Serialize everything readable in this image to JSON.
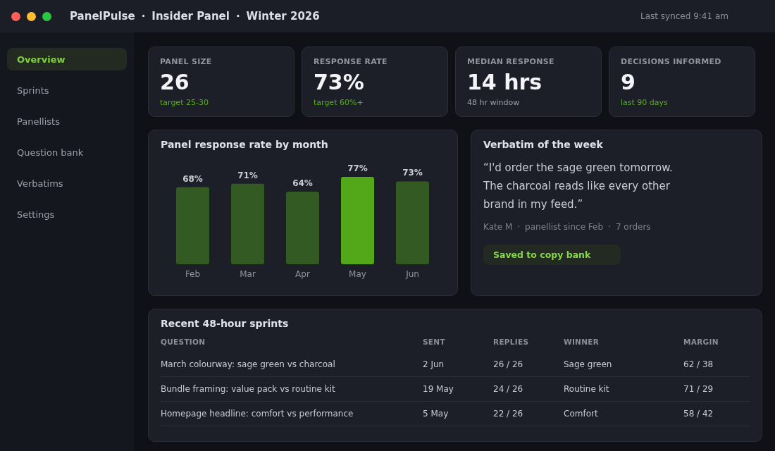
{
  "window": {
    "title_parts": [
      "PanelPulse",
      "Insider Panel",
      "Winter 2026"
    ],
    "separator": "·",
    "sync": "Last synced 9:41 am"
  },
  "sidebar": {
    "items": [
      {
        "label": "Overview",
        "selected": true
      },
      {
        "label": "Sprints",
        "selected": false
      },
      {
        "label": "Panellists",
        "selected": false
      },
      {
        "label": "Question bank",
        "selected": false
      },
      {
        "label": "Verbatims",
        "selected": false
      },
      {
        "label": "Settings",
        "selected": false
      }
    ]
  },
  "stats": [
    {
      "label": "PANEL SIZE",
      "value": "26",
      "note": "target 25-30",
      "color": "#5aad1c"
    },
    {
      "label": "RESPONSE RATE",
      "value": "73%",
      "note": "target 60%+",
      "color": "#5aad1c"
    },
    {
      "label": "MEDIAN RESPONSE",
      "value": "14 hrs",
      "note": "48 hr window",
      "color": "#9aa0ab"
    },
    {
      "label": "DECISIONS INFORMED",
      "value": "9",
      "note": "last 90 days",
      "color": "#5aad1c"
    }
  ],
  "chart": {
    "chart_data": {
      "type": "bar",
      "title": "Panel response rate by month",
      "categories": [
        "Feb",
        "Mar",
        "Apr",
        "May",
        "Jun"
      ],
      "series": [
        {
          "color": "#335a22",
          "values": [
            68,
            71,
            64,
            null,
            73
          ],
          "value_labels": [
            "68%",
            "71%",
            "64%",
            null,
            "73%"
          ]
        },
        {
          "color": "#52a818",
          "values": [
            null,
            null,
            null,
            77,
            null
          ],
          "value_labels": [
            null,
            null,
            null,
            "77%",
            null
          ]
        }
      ]
    }
  },
  "verbatim": {
    "title": "Verbatim of the week",
    "quote": "“I'd order the sage green tomorrow. The charcoal reads like every other brand in my feed.”",
    "meta": [
      "Kate M",
      "panellist since Feb",
      "7 orders"
    ],
    "badge": "Saved to copy bank"
  },
  "sprints": {
    "title": "Recent 48-hour sprints",
    "columns": [
      "QUESTION",
      "SENT",
      "REPLIES",
      "WINNER",
      "MARGIN"
    ],
    "rows": [
      [
        "March colourway: sage green vs charcoal",
        "2 Jun",
        "26 / 26",
        "Sage green",
        "62 / 38"
      ],
      [
        "Bundle framing: value pack vs routine kit",
        "19 May",
        "24 / 26",
        "Routine kit",
        "71 / 29"
      ],
      [
        "Homepage headline: comfort vs performance",
        "5 May",
        "22 / 26",
        "Comfort",
        "58 / 42"
      ]
    ]
  }
}
